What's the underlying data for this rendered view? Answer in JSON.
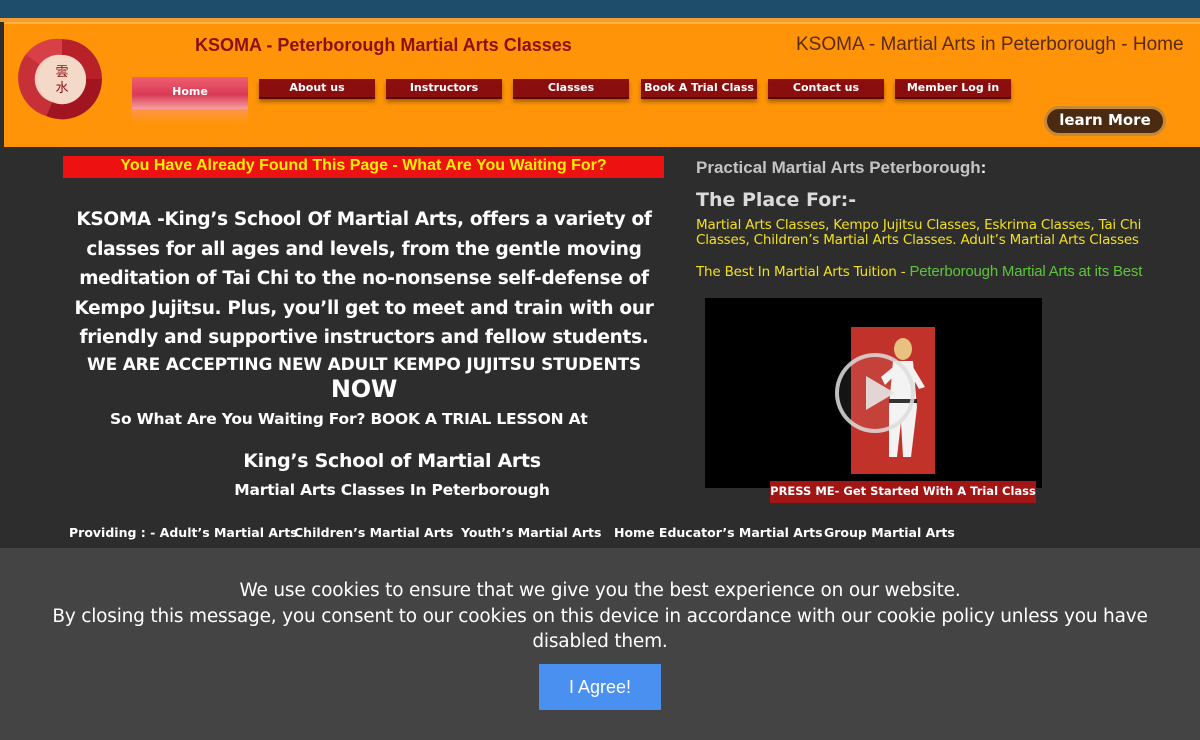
{
  "header": {
    "site_title": "KSOMA - Peterborough Martial Arts Classes",
    "tagline": "KSOMA - Martial Arts in Peterborough - Home",
    "logo_icon": "ksoma-logo-icon",
    "learn_more": "learn More"
  },
  "nav": {
    "items": [
      {
        "label": "Home"
      },
      {
        "label": "About us"
      },
      {
        "label": "Instructors"
      },
      {
        "label": "Classes"
      },
      {
        "label": "Book A Trial Class"
      },
      {
        "label": "Contact us"
      },
      {
        "label": "Member Log in"
      }
    ]
  },
  "main": {
    "banner": "You Have Already Found This Page - What Are You Waiting For?",
    "intro": "KSOMA -King’s School Of Martial Arts, offers a variety of classes for all ages and levels, from the gentle moving meditation of Tai Chi to the no-nonsense self-defense of Kempo Jujitsu. Plus, you’ll get to meet and train with our friendly and supportive instructors and fellow students.",
    "accepting": "WE ARE ACCEPTING NEW ADULT KEMPO JUJITSU STUDENTS",
    "accepting_now": "NOW",
    "waiting": "So What Are You Waiting For? BOOK A TRIAL LESSON At",
    "school_name": "King’s School of Martial Arts",
    "school_sub": "Martial Arts Classes In Peterborough",
    "providing": [
      "Providing : - Adult’s Martial Arts",
      "Children’s Martial Arts",
      "Youth’s Martial Arts",
      "Home Educator’s Martial Arts",
      "Group Martial Arts"
    ]
  },
  "right": {
    "heading": "Practical Martial Arts Peterborough",
    "heading_colon": ":",
    "place_for": "The Place For:-",
    "classes": "Martial Arts Classes, Kempo Jujitsu Classes, Eskrima Classes, Tai Chi Classes, Children’s Martial Arts Classes. Adult’s Martial Arts Classes",
    "best_prefix": "The Best In Martial Arts Tuition - ",
    "best_green": "Peterborough Martial Arts at its Best",
    "video_button": "PRESS ME- Get Started With A Trial Class",
    "play_icon": "play-icon"
  },
  "cookie": {
    "line1": "We use cookies to ensure that we give you the best experience on our website.",
    "line2": "By closing this message, you consent to our cookies on this device in accordance with our cookie policy unless you have disabled them.",
    "agree": "I Agree!"
  },
  "colors": {
    "header_orange": "#ff9408",
    "nav_red": "#8b0e0e",
    "banner_red": "#ee1111",
    "banner_yellow": "#ffef00",
    "agree_blue": "#4a90f0"
  }
}
